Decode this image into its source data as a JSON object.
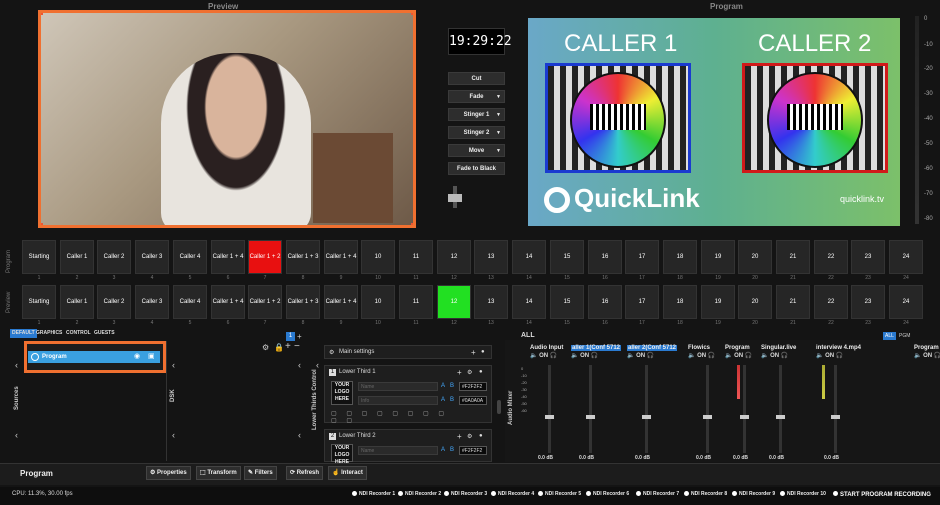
{
  "header": {
    "preview_label": "Preview",
    "program_label": "Program"
  },
  "program_feed": {
    "caller1": "CALLER 1",
    "caller2": "CALLER 2",
    "brand": "QuickLink",
    "url": "quicklink.tv"
  },
  "clock": "19:29:22",
  "transitions": [
    "Cut",
    "Fade",
    "Stinger 1",
    "Stinger 2",
    "Move",
    "Fade to Black"
  ],
  "vu_scale": [
    "0",
    "-10",
    "-20",
    "-30",
    "-40",
    "-50",
    "-60",
    "-70",
    "-80"
  ],
  "row_labels": {
    "program": "Program",
    "preview": "Preview"
  },
  "program_row": [
    "Starting",
    "Caller 1",
    "Caller 2",
    "Caller 3",
    "Caller 4",
    "Caller 1 + 4",
    "Caller 1 + 2",
    "Caller 1 + 3",
    "Caller 1 + 4",
    "10",
    "11",
    "12",
    "13",
    "14",
    "15",
    "16",
    "17",
    "18",
    "19",
    "20",
    "21",
    "22",
    "23",
    "24"
  ],
  "preview_row": [
    "Starting",
    "Caller 1",
    "Caller 2",
    "Caller 3",
    "Caller 4",
    "Caller 1 + 4",
    "Caller 1 + 2",
    "Caller 1 + 3",
    "Caller 1 + 4",
    "10",
    "11",
    "12",
    "13",
    "14",
    "15",
    "16",
    "17",
    "18",
    "19",
    "20",
    "21",
    "22",
    "23",
    "24"
  ],
  "scene_numbers": [
    "1",
    "2",
    "3",
    "4",
    "5",
    "6",
    "7",
    "8",
    "9",
    "10",
    "11",
    "12",
    "13",
    "14",
    "15",
    "16",
    "17",
    "18",
    "19",
    "20",
    "21",
    "22",
    "23",
    "24"
  ],
  "program_active_index": 6,
  "preview_active_index": 11,
  "active_colors": {
    "program": "#e81010",
    "preview": "#22e022"
  },
  "tabs": [
    "DEFAULT",
    "GRAPHICS",
    "CONTROL",
    "GUESTS"
  ],
  "page_badge": "1",
  "sources": {
    "label": "Sources",
    "item": "Program"
  },
  "dsk_label": "DSK",
  "lower_thirds": {
    "section_label": "Lower Thirds Control",
    "main_settings": "Main settings",
    "lt1": {
      "title": "Lower Third 1",
      "name_ph": "Name",
      "info_ph": "Info",
      "hex1": "#F2F2F2",
      "hex2": "#0A0A0A",
      "logo": "YOUR LOGO HERE"
    },
    "lt2": {
      "title": "Lower Third 2",
      "name_ph": "Name",
      "hex1": "#F2F2F2",
      "logo": "YOUR LOGO HERE"
    }
  },
  "mixer": {
    "title": "ALL",
    "side_label": "Audio Mixer",
    "tabs": [
      "ALL",
      "PGM"
    ],
    "channels": [
      "Audio Input",
      "aller 1(Conf 5712",
      "aller 2(Conf 5712",
      "Flowics",
      "Program",
      "Singular.live",
      "interview 4.mp4",
      "Program"
    ],
    "on_label": "ON",
    "db_label": "0.0 dB",
    "scale": [
      "0",
      "-10",
      "-20",
      "-30",
      "-40",
      "-50",
      "-60"
    ]
  },
  "bottom": {
    "title": "Program",
    "buttons": [
      "Properties",
      "Transform",
      "Filters",
      "Refresh",
      "Interact"
    ]
  },
  "status": {
    "cpu": "CPU: 11.3%, 30.00 fps",
    "recorders": [
      "NDI Recorder 1",
      "NDI Recorder 2",
      "NDI Recorder 3",
      "NDI Recorder 4",
      "NDI Recorder 5",
      "NDI Recorder 6",
      "NDI Recorder 7",
      "NDI Recorder 8",
      "NDI Recorder 9",
      "NDI Recorder 10"
    ],
    "start_recording": "START PROGRAM RECORDING"
  }
}
